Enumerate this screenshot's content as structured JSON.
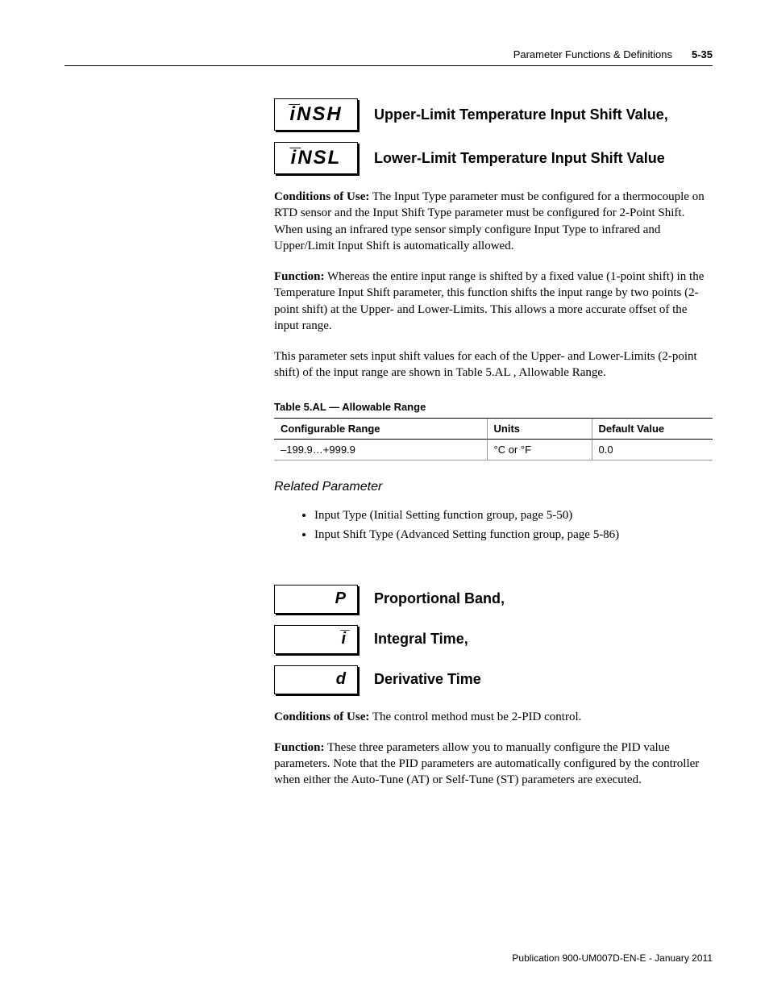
{
  "header": {
    "section": "Parameter Functions & Definitions",
    "page": "5-35"
  },
  "section1": {
    "boxes": [
      "i̅NSH",
      "i̅NSL"
    ],
    "titles": [
      "Upper-Limit Temperature Input Shift Value,",
      "Lower-Limit Temperature Input Shift Value"
    ],
    "conditions_label": "Conditions of Use:",
    "conditions_text": " The Input Type parameter must be configured for a thermocouple on RTD sensor and the Input Shift Type parameter must be configured for 2-Point Shift. When using an infrared type sensor simply configure Input Type to infrared and Upper/Limit Input Shift is automatically allowed.",
    "function_label": "Function:",
    "function_text": " Whereas the entire input range is shifted by a fixed value (1-point shift) in the Temperature Input Shift parameter, this function shifts the input range by two points (2-point shift) at the Upper- and Lower-Limits. This allows a more accurate offset of the input range.",
    "extra_text": "This parameter sets input shift values for each of the Upper- and Lower-Limits (2-point shift) of the input range are shown in Table 5.AL , Allowable Range.",
    "table_caption": "Table 5.AL — Allowable Range",
    "table": {
      "headers": [
        "Configurable Range",
        "Units",
        "Default Value"
      ],
      "row": [
        "–199.9…+999.9",
        "°C or °F",
        "0.0"
      ]
    },
    "related_heading": "Related Parameter",
    "related_items": [
      "Input Type (Initial Setting function group, page 5-50)",
      "Input Shift Type (Advanced Setting function group, page 5-86)"
    ]
  },
  "section2": {
    "boxes": [
      "P",
      "i̅",
      "d"
    ],
    "titles": [
      "Proportional Band,",
      "Integral Time,",
      "Derivative Time"
    ],
    "conditions_label": "Conditions of Use:",
    "conditions_text": " The control method must be 2-PID control.",
    "function_label": "Function:",
    "function_text": " These three parameters allow you to manually configure the PID value parameters. Note that the PID parameters are automatically configured by the controller when either the Auto-Tune (AT) or Self-Tune (ST) parameters are executed."
  },
  "footer": "Publication 900-UM007D-EN-E - January 2011"
}
